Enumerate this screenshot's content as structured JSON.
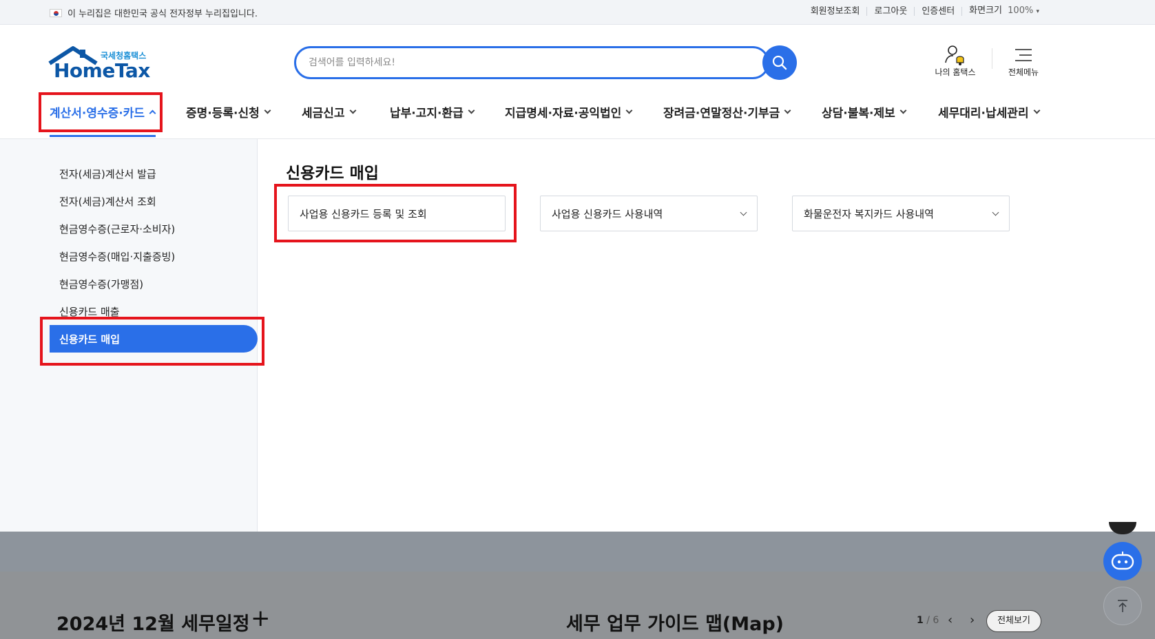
{
  "topbar": {
    "gov_notice": "이 누리집은 대한민국 공식 전자정부 누리집입니다.",
    "links": [
      "회원정보조회",
      "로그아웃",
      "인증센터",
      "화면크기"
    ],
    "zoom": "100%"
  },
  "header": {
    "logo_sub": "국세청홈택스",
    "logo_main": "HomeTax",
    "search_placeholder": "검색어를 입력하세요!",
    "my_hometax": "나의 홈택스",
    "all_menu": "전체메뉴"
  },
  "gnb": {
    "items": [
      "계산서·영수증·카드",
      "증명·등록·신청",
      "세금신고",
      "납부·고지·환급",
      "지급명세·자료·공익법인",
      "장려금·연말정산·기부금",
      "상담·불복·제보",
      "세무대리·납세관리"
    ]
  },
  "mega": {
    "side_items": [
      "전자(세금)계산서 발급",
      "전자(세금)계산서 조회",
      "현금영수증(근로자·소비자)",
      "현금영수증(매입·지출증빙)",
      "현금영수증(가맹점)",
      "신용카드 매출",
      "신용카드 매입"
    ],
    "title": "신용카드 매입",
    "cards": [
      "사업용 신용카드 등록 및 조회",
      "사업용 신용카드 사용내역",
      "화물운전자 복지카드 사용내역"
    ]
  },
  "bottom": {
    "schedule_title": "2024년 12월 세무일정",
    "guide_title": "세무 업무 가이드 맵(Map)",
    "page_current": "1",
    "page_total": "/ 6",
    "view_all": "전체보기"
  },
  "colors": {
    "accent": "#2a6fe8",
    "highlight": "#e5141c"
  }
}
